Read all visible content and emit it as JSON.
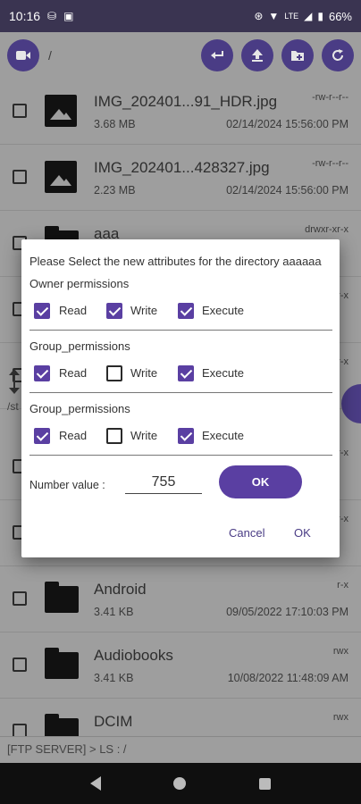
{
  "status_bar": {
    "time": "10:16",
    "battery": "66%",
    "network": "LTE"
  },
  "toolbar": {
    "path": "/"
  },
  "files": [
    {
      "name": "IMG_202401...91_HDR.jpg",
      "size": "3.68 MB",
      "perm": "-rw-r--r--",
      "date": "02/14/2024 15:56:00 PM",
      "type": "image"
    },
    {
      "name": "IMG_202401...428327.jpg",
      "size": "2.23 MB",
      "perm": "-rw-r--r--",
      "date": "02/14/2024 15:56:00 PM",
      "type": "image"
    },
    {
      "name": "aaa",
      "size": "",
      "perm": "drwxr-xr-x",
      "date": "",
      "type": "folder"
    },
    {
      "name": "",
      "size": "",
      "perm": "r-x",
      "date": "",
      "type": "folder"
    },
    {
      "name": "",
      "size": "",
      "perm": "r-x",
      "date": "",
      "type": "folder"
    },
    {
      "name": "",
      "size": "",
      "perm": "r-x",
      "date": "",
      "type": "folder"
    },
    {
      "name": "",
      "size": "",
      "perm": "r-x",
      "date": "",
      "type": "folder"
    },
    {
      "name": "Android",
      "size": "3.41 KB",
      "perm": "r-x",
      "date": "09/05/2022 17:10:03 PM",
      "type": "folder"
    },
    {
      "name": "Audiobooks",
      "size": "3.41 KB",
      "perm": "rwx",
      "date": "10/08/2022 11:48:09 AM",
      "type": "folder"
    },
    {
      "name": "DCIM",
      "size": "",
      "perm": "rwx",
      "date": "",
      "type": "folder"
    }
  ],
  "terminal": {
    "text": "[FTP SERVER] > LS : /"
  },
  "side_fragment": {
    "text": "/st"
  },
  "dialog": {
    "title": "Please Select the new attributes for the directory aaaaaa",
    "sections": [
      {
        "label": "Owner permissions",
        "read": true,
        "write": true,
        "execute": true
      },
      {
        "label": "Group_permissions",
        "read": true,
        "write": false,
        "execute": true
      },
      {
        "label": "Group_permissions",
        "read": true,
        "write": false,
        "execute": true
      }
    ],
    "labels": {
      "read": "Read",
      "write": "Write",
      "execute": "Execute"
    },
    "number_label": "Number value :",
    "number_value": "755",
    "ok_pill": "OK",
    "cancel": "Cancel",
    "ok": "OK"
  }
}
